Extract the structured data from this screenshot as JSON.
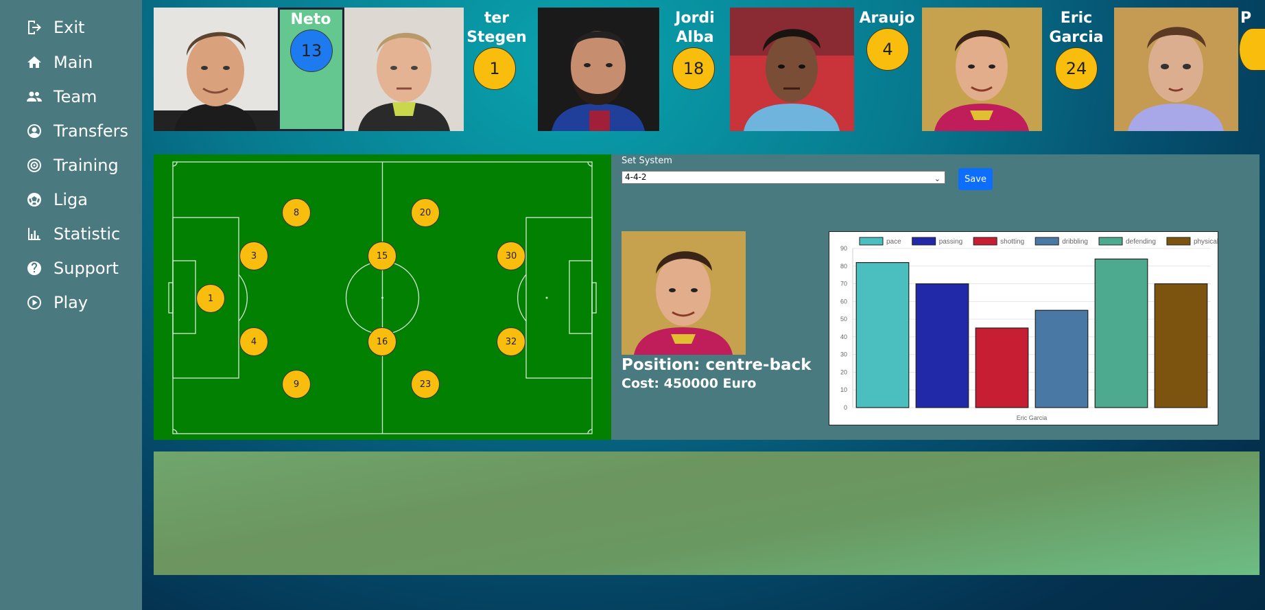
{
  "sidebar": {
    "items": [
      {
        "label": "Exit",
        "icon": "exit-icon"
      },
      {
        "label": "Main",
        "icon": "home-icon"
      },
      {
        "label": "Team",
        "icon": "team-icon"
      },
      {
        "label": "Transfers",
        "icon": "user-circle-icon"
      },
      {
        "label": "Training",
        "icon": "target-icon"
      },
      {
        "label": "Liga",
        "icon": "soccer-ball-icon"
      },
      {
        "label": "Statistic",
        "icon": "bar-chart-icon"
      },
      {
        "label": "Support",
        "icon": "question-icon"
      },
      {
        "label": "Play",
        "icon": "play-icon"
      }
    ]
  },
  "roster": {
    "players": [
      {
        "name": "Neto",
        "number": "13",
        "selected": true
      },
      {
        "name": "ter Stegen",
        "number": "1"
      },
      {
        "name": "Jordi Alba",
        "number": "18"
      },
      {
        "name": "Araujo",
        "number": "4"
      },
      {
        "name": "Eric Garcia",
        "number": "24"
      },
      {
        "name": "P",
        "number": ""
      }
    ]
  },
  "formation": {
    "label": "Set System",
    "selected": "4-4-2",
    "save_label": "Save",
    "positions": [
      "1",
      "3",
      "4",
      "8",
      "9",
      "15",
      "16",
      "20",
      "23",
      "30",
      "32"
    ]
  },
  "player_detail": {
    "position": "Position: centre-back",
    "cost": "Cost: 450000 Euro"
  },
  "colors": {
    "number_badge": "#f9bd0e",
    "selected_badge": "#1e7bef",
    "pitch": "#018002",
    "save_button": "#0d6efd"
  },
  "chart_data": {
    "type": "bar",
    "categories": [
      "pace",
      "passing",
      "shotting",
      "dribbling",
      "defending",
      "physical"
    ],
    "series": [
      {
        "name": "pace",
        "values": [
          82
        ],
        "color": "#4bbfbf"
      },
      {
        "name": "passing",
        "values": [
          70
        ],
        "color": "#2229a8"
      },
      {
        "name": "shotting",
        "values": [
          45
        ],
        "color": "#c81e34"
      },
      {
        "name": "dribbling",
        "values": [
          55
        ],
        "color": "#4a78a4"
      },
      {
        "name": "defending",
        "values": [
          84
        ],
        "color": "#4daa8e"
      },
      {
        "name": "physical",
        "values": [
          70
        ],
        "color": "#7c5410"
      }
    ],
    "xlabel": "Eric Garcia",
    "ylabel": "",
    "ylim": [
      0,
      90
    ],
    "yticks": [
      "0",
      "10",
      "20",
      "30",
      "40",
      "50",
      "60",
      "70",
      "80",
      "90"
    ],
    "legend_position": "top",
    "grid": true
  }
}
